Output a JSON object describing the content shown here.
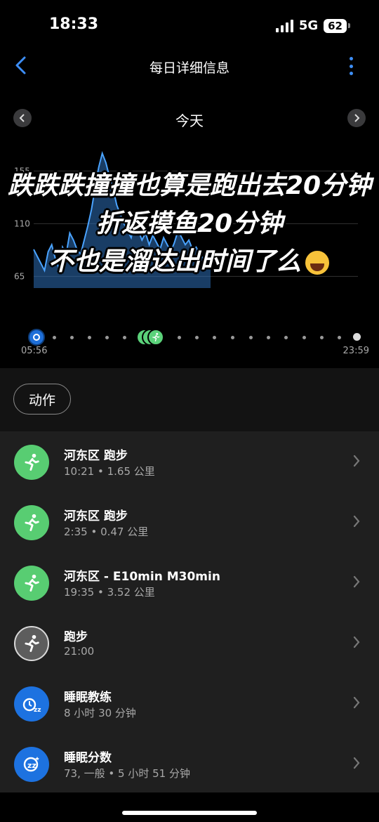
{
  "status": {
    "time": "18:33",
    "network": "5G",
    "battery": "62"
  },
  "nav": {
    "title": "每日详细信息"
  },
  "day": {
    "label": "今天"
  },
  "chart_data": {
    "type": "area",
    "title": "",
    "xlabel": "",
    "ylabel": "",
    "y_ticks": [
      "155",
      "110",
      "65"
    ],
    "ylim": [
      55,
      175
    ],
    "series": [
      {
        "values": [
          88,
          82,
          76,
          70,
          86,
          92,
          80,
          72,
          90,
          84,
          102,
          96,
          88,
          84,
          96,
          108,
          122,
          140,
          158,
          170,
          162,
          150,
          140,
          126,
          118,
          110,
          104,
          98,
          112,
          104,
          96,
          102,
          92,
          100,
          94,
          88,
          98,
          92,
          86,
          94,
          104,
          98,
          92,
          96,
          88,
          90,
          84,
          80,
          86,
          78
        ]
      }
    ],
    "colors": {
      "line": "#4aa3ff",
      "fill": "#2e6fb8"
    }
  },
  "caption": {
    "line1": "跌跌跌撞撞也算是跑出去20分钟",
    "line2": "折返摸鱼20分钟",
    "line3": "不也是溜达出时间了么"
  },
  "timeline": {
    "start": "05:56",
    "end": "23:59"
  },
  "section": {
    "chip": "动作"
  },
  "activities": [
    {
      "title": "河东区 跑步",
      "sub": "10:21 • 1.65 公里",
      "icon": "running-icon"
    },
    {
      "title": "河东区 跑步",
      "sub": "2:35 • 0.47 公里",
      "icon": "running-icon"
    },
    {
      "title": "河东区 - E10min M30min",
      "sub": "19:35 • 3.52 公里",
      "icon": "running-icon"
    },
    {
      "title": "跑步",
      "sub": "21:00",
      "icon": "running-icon"
    },
    {
      "title": "睡眠教练",
      "sub": "8 小时 30 分钟",
      "icon": "sleep-coach-icon"
    },
    {
      "title": "睡眠分数",
      "sub": "73, 一般 • 5 小时 51 分钟",
      "icon": "sleep-score-icon"
    }
  ]
}
